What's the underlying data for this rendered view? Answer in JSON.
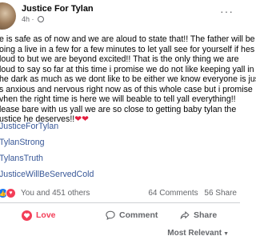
{
  "post": {
    "author": "Justice For Tylan",
    "time": "4h",
    "more": "···",
    "lines": [
      "e is safe as of now and we are aloud to state that!! The father will be",
      "oing a live in a few for a few minutes to let yall see for yourself if hes",
      "loud to but we are beyond excited!! That is the only thing we are",
      "loud to say so far at this time i promise we do not like keeping yall in",
      "he dark as much as we dont like to be either we know everyone is jus",
      "s anxious and nervous right now as of this whole case but i promise",
      "vhen the right time is here we will beable to tell yall everything!!",
      "lease bare with us yall we are so close to getting baby tylan the",
      "ustice he deserves!!"
    ],
    "hearts": "❤❤",
    "hashtags": [
      "JusticeForTylan",
      "TylanStrong",
      "TylansTruth",
      "JusticeWillBeServedCold"
    ]
  },
  "stats": {
    "reactions_text": "You and 451 others",
    "comments": "64 Comments",
    "shares": "56 Share"
  },
  "actions": {
    "love": "Love",
    "comment": "Comment",
    "share": "Share"
  },
  "comments_sort": "Most Relevant",
  "colors": {
    "link": "#385898",
    "love": "#f33e58",
    "like": "#1877f2",
    "muted": "#65676b"
  }
}
